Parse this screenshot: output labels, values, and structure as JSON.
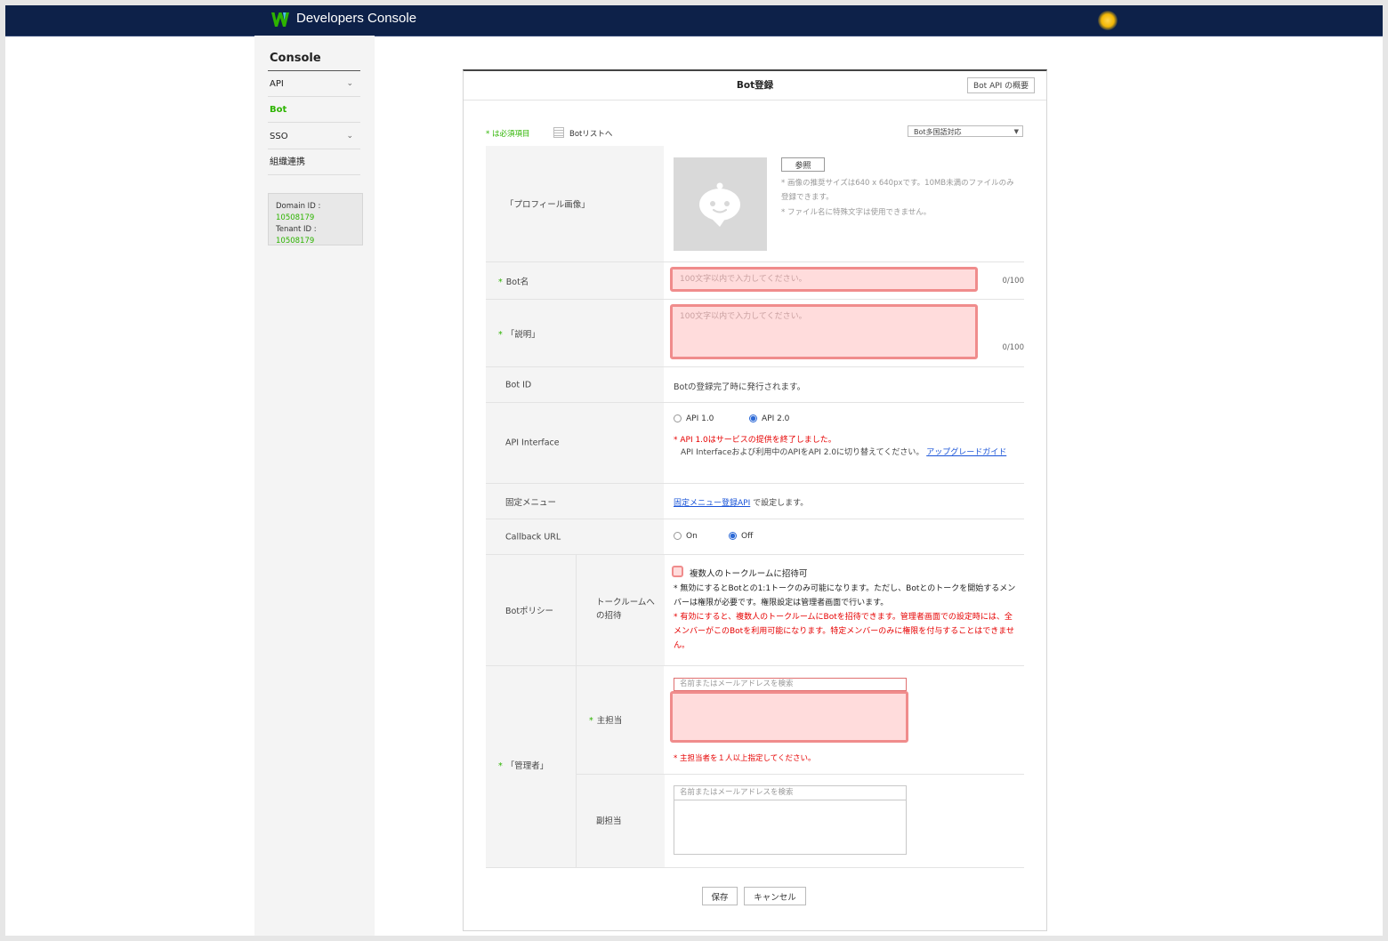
{
  "header": {
    "brand": "Developers Console"
  },
  "sidebar": {
    "title": "Console",
    "items": [
      {
        "label": "API",
        "expandable": true,
        "active": false
      },
      {
        "label": "Bot",
        "expandable": false,
        "active": true
      },
      {
        "label": "SSO",
        "expandable": true,
        "active": false
      },
      {
        "label": "組織連携",
        "expandable": false,
        "active": false
      }
    ],
    "domain_label": "Domain ID :",
    "domain_id": "10508179",
    "tenant_label": "Tenant ID :",
    "tenant_id": "10508179"
  },
  "panel": {
    "title": "Bot登録",
    "overview_button": "Bot API の概要",
    "required_note": "* は必須項目",
    "list_link": "Botリストへ",
    "lang_select": "Bot多国語対応"
  },
  "form": {
    "profile": {
      "label": "「プロフィール画像」",
      "browse": "参照",
      "hint1": "* 画像の推奨サイズは640 x 640pxです。10MB未満のファイルのみ登録できます。",
      "hint2": "* ファイル名に特殊文字は使用できません。"
    },
    "bot_name": {
      "label": "Bot名",
      "placeholder": "100文字以内で入力してください。",
      "counter": "0/100"
    },
    "description": {
      "label": "「説明」",
      "placeholder": "100文字以内で入力してください。",
      "counter": "0/100"
    },
    "bot_id": {
      "label": "Bot ID",
      "value": "Botの登録完了時に発行されます。"
    },
    "api_interface": {
      "label": "API Interface",
      "options": [
        "API 1.0",
        "API 2.0"
      ],
      "selected": "API 2.0",
      "warning": "* API 1.0はサービスの提供を終了しました。",
      "note": "API Interfaceおよび利用中のAPIをAPI 2.0に切り替えてください。",
      "link": "アップグレードガイド"
    },
    "fixed_menu": {
      "label": "固定メニュー",
      "link": "固定メニュー登録API",
      "suffix": " で設定します。"
    },
    "callback": {
      "label": "Callback URL",
      "options": [
        "On",
        "Off"
      ],
      "selected": "Off"
    },
    "policy": {
      "label": "Botポリシー",
      "sub_label": "トークルームへの招待",
      "checkbox": "複数人のトークルームに招待可",
      "note1": "* 無効にするとBotとの1:1トークのみ可能になります。ただし、Botとのトークを開始するメンバーは権限が必要です。権限設定は管理者画面で行います。",
      "note2": "* 有効にすると、複数人のトークルームにBotを招待できます。管理者画面での設定時には、全メンバーがこのBotを利用可能になります。特定メンバーのみに権限を付与することはできません。"
    },
    "admin": {
      "label": "「管理者」",
      "primary_label": "主担当",
      "primary_placeholder": "名前またはメールアドレスを検索",
      "primary_error": "* 主担当者を１人以上指定してください。",
      "secondary_label": "副担当",
      "secondary_placeholder": "名前またはメールアドレスを検索"
    }
  },
  "buttons": {
    "save": "保存",
    "cancel": "キャンセル"
  },
  "colors": {
    "header": "#0d2149",
    "accent_green": "#2db400",
    "error_red": "#e60000",
    "error_bg": "#ffdcdc"
  }
}
